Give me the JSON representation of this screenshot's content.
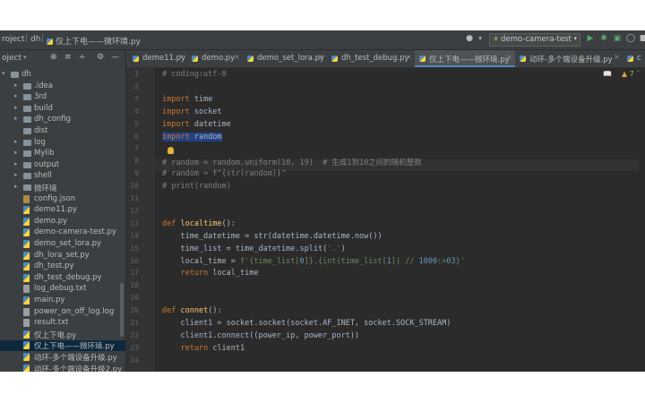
{
  "breadcrumb": {
    "project": "roject",
    "folder": "dh",
    "file": "仅上下电——微环境.py"
  },
  "toolbar": {
    "run_config": "demo-camera-test",
    "icons": [
      "user-icon",
      "run-icon",
      "debug-icon",
      "coverage-icon",
      "stop-icon"
    ]
  },
  "project_panel": {
    "title": "oject",
    "tree": [
      {
        "label": "dh",
        "kind": "folder",
        "depth": 0,
        "open": true
      },
      {
        "label": ".idea",
        "kind": "folder",
        "depth": 1
      },
      {
        "label": "3rd",
        "kind": "folder",
        "depth": 1
      },
      {
        "label": "build",
        "kind": "folder",
        "depth": 1
      },
      {
        "label": "dh_config",
        "kind": "folder",
        "depth": 1
      },
      {
        "label": "dist",
        "kind": "folder",
        "depth": 1,
        "noarrow": true
      },
      {
        "label": "log",
        "kind": "folder",
        "depth": 1
      },
      {
        "label": "Mylib",
        "kind": "folder",
        "depth": 1
      },
      {
        "label": "output",
        "kind": "folder",
        "depth": 1
      },
      {
        "label": "shell",
        "kind": "folder",
        "depth": 1
      },
      {
        "label": "微环境",
        "kind": "folder",
        "depth": 1
      },
      {
        "label": "config.json",
        "kind": "json",
        "depth": 1
      },
      {
        "label": "deme11.py",
        "kind": "py",
        "depth": 1
      },
      {
        "label": "demo.py",
        "kind": "py",
        "depth": 1
      },
      {
        "label": "demo-camera-test.py",
        "kind": "py",
        "depth": 1
      },
      {
        "label": "demo_set_lora.py",
        "kind": "py",
        "depth": 1
      },
      {
        "label": "dh_lora_set.py",
        "kind": "py",
        "depth": 1
      },
      {
        "label": "dh_test.py",
        "kind": "py",
        "depth": 1
      },
      {
        "label": "dh_test_debug.py",
        "kind": "py",
        "depth": 1
      },
      {
        "label": "log_debug.txt",
        "kind": "txt",
        "depth": 1
      },
      {
        "label": "main.py",
        "kind": "py",
        "depth": 1
      },
      {
        "label": "power_on_off_log.log",
        "kind": "txt",
        "depth": 1
      },
      {
        "label": "result.txt",
        "kind": "txt",
        "depth": 1
      },
      {
        "label": "仅上下电.py",
        "kind": "py",
        "depth": 1
      },
      {
        "label": "仅上下电——微环境.py",
        "kind": "py",
        "depth": 1,
        "selected": true
      },
      {
        "label": "动环-多个端设备升级.py",
        "kind": "py",
        "depth": 1
      },
      {
        "label": "动环-多个端设备升级2.py",
        "kind": "py",
        "depth": 1
      }
    ]
  },
  "tabs": [
    {
      "label": "deme11.py"
    },
    {
      "label": "demo.py"
    },
    {
      "label": "demo_set_lora.py"
    },
    {
      "label": "dh_test_debug.py"
    },
    {
      "label": "仅上下电——微环境.py",
      "active": true
    },
    {
      "label": "动环-多个端设备升级.py"
    },
    {
      "label": "c"
    }
  ],
  "editor": {
    "inspection_count": "7",
    "lines": [
      {
        "n": "1",
        "text": "# coding:utf-8"
      },
      {
        "n": "2",
        "text": ""
      },
      {
        "n": "3",
        "text": "import time"
      },
      {
        "n": "4",
        "text": "import socket"
      },
      {
        "n": "5",
        "text": "import datetime"
      },
      {
        "n": "6",
        "text": "import random"
      },
      {
        "n": "7",
        "text": ""
      },
      {
        "n": "8",
        "text": "# random = random.uniform(10, 19)  # 生成1到10之间的随机整数"
      },
      {
        "n": "9",
        "text": "# random = f\"{str(random)}\""
      },
      {
        "n": "10",
        "text": "# print(random)"
      },
      {
        "n": "11",
        "text": ""
      },
      {
        "n": "12",
        "text": ""
      },
      {
        "n": "13",
        "text": "def localtime():"
      },
      {
        "n": "14",
        "text": "    time_datetime = str(datetime.datetime.now())"
      },
      {
        "n": "15",
        "text": "    time_list = time_datetime.split('.')"
      },
      {
        "n": "16",
        "text": "    local_time = f'{time_list[0]}.{int(time_list[1]) // 1000:>03}'"
      },
      {
        "n": "17",
        "text": "    return local_time"
      },
      {
        "n": "18",
        "text": ""
      },
      {
        "n": "19",
        "text": ""
      },
      {
        "n": "20",
        "text": "def connet():"
      },
      {
        "n": "21",
        "text": "    client1 = socket.socket(socket.AF_INET, socket.SOCK_STREAM)"
      },
      {
        "n": "22",
        "text": "    client1.connect((power_ip, power_port))"
      },
      {
        "n": "23",
        "text": "    return client1"
      },
      {
        "n": "24",
        "text": ""
      }
    ]
  },
  "colors": {
    "keyword": "#cc7832",
    "comment": "#808080",
    "function": "#ffc66d",
    "number": "#6897bb",
    "string": "#6a8759",
    "selection": "#214283"
  }
}
